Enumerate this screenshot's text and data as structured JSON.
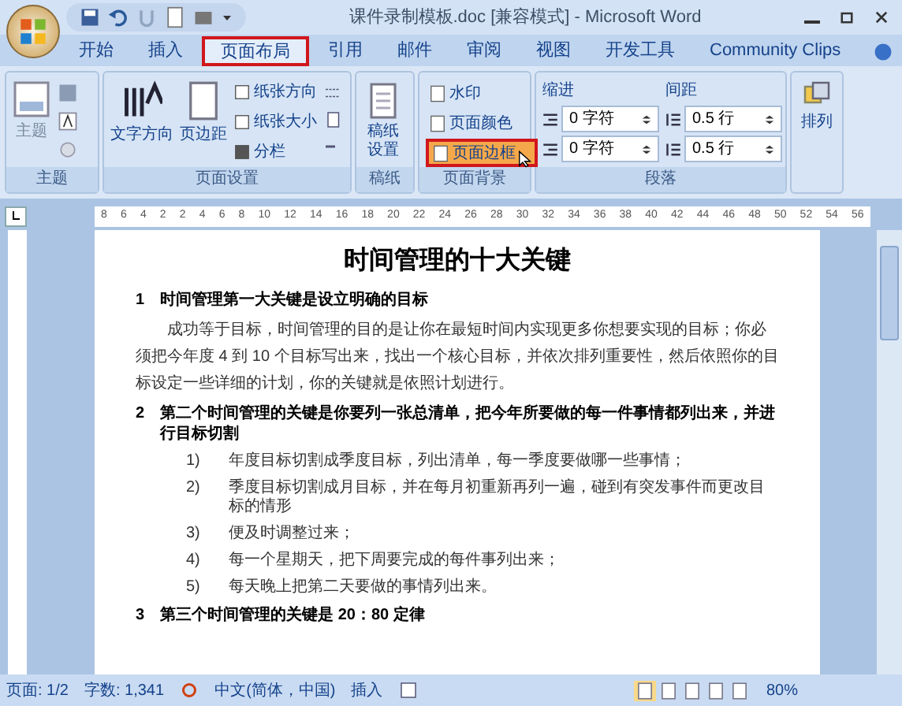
{
  "window": {
    "title": "课件录制模板.doc [兼容模式] - Microsoft Word"
  },
  "tabs": [
    {
      "label": "开始",
      "selected": false
    },
    {
      "label": "插入",
      "selected": false
    },
    {
      "label": "页面布局",
      "selected": true
    },
    {
      "label": "引用",
      "selected": false
    },
    {
      "label": "邮件",
      "selected": false
    },
    {
      "label": "审阅",
      "selected": false
    },
    {
      "label": "视图",
      "selected": false
    },
    {
      "label": "开发工具",
      "selected": false
    },
    {
      "label": "Community Clips",
      "selected": false
    }
  ],
  "ribbon": {
    "theme": {
      "label": "主题",
      "button": "主题"
    },
    "page_setup": {
      "label": "页面设置",
      "buttons": [
        "文字方向",
        "页边距"
      ],
      "menus": [
        "纸张方向",
        "纸张大小",
        "分栏"
      ]
    },
    "manuscript": {
      "label": "稿纸",
      "button": "稿纸设置"
    },
    "background": {
      "label": "页面背景",
      "items": [
        {
          "label": "水印",
          "selected": false
        },
        {
          "label": "页面颜色",
          "selected": false
        },
        {
          "label": "页面边框",
          "selected": true
        }
      ]
    },
    "paragraph": {
      "label": "段落",
      "indent_label": "缩进",
      "spacing_label": "间距",
      "indent": [
        "0 字符",
        "0 字符"
      ],
      "spacing": [
        "0.5 行",
        "0.5 行"
      ]
    },
    "arrange": {
      "button": "排列"
    }
  },
  "ruler": {
    "ticks": [
      "8",
      "6",
      "4",
      "2",
      "2",
      "4",
      "6",
      "8",
      "10",
      "12",
      "14",
      "16",
      "18",
      "20",
      "22",
      "24",
      "26",
      "28",
      "30",
      "32",
      "34",
      "36",
      "38",
      "40",
      "42",
      "44",
      "46",
      "48",
      "50",
      "52",
      "54",
      "56"
    ]
  },
  "document": {
    "title": "时间管理的十大关键",
    "blocks": [
      {
        "kind": "heading",
        "number": "1",
        "text": "时间管理第一大关键是设立明确的目标"
      },
      {
        "kind": "paragraph",
        "text": "成功等于目标，时间管理的目的是让你在最短时间内实现更多你想要实现的目标；你必须把今年度 4 到 10 个目标写出来，找出一个核心目标，并依次排列重要性，然后依照你的目标设定一些详细的计划，你的关键就是依照计划进行。"
      },
      {
        "kind": "heading",
        "number": "2",
        "text": "第二个时间管理的关键是你要列一张总清单，把今年所要做的每一件事情都列出来，并进行目标切割"
      },
      {
        "kind": "item",
        "number": "1)",
        "text": "年度目标切割成季度目标，列出清单，每一季度要做哪一些事情；"
      },
      {
        "kind": "item",
        "number": "2)",
        "text": "季度目标切割成月目标，并在每月初重新再列一遍，碰到有突发事件而更改目标的情形"
      },
      {
        "kind": "item",
        "number": "3)",
        "text": "便及时调整过来；"
      },
      {
        "kind": "item",
        "number": "4)",
        "text": "每一个星期天，把下周要完成的每件事列出来；"
      },
      {
        "kind": "item",
        "number": "5)",
        "text": "每天晚上把第二天要做的事情列出来。"
      },
      {
        "kind": "heading",
        "number": "3",
        "text": "第三个时间管理的关键是 20：80 定律"
      }
    ]
  },
  "status_bar": {
    "page": "页面: 1/2",
    "words": "字数: 1,341",
    "language": "中文(简体，中国)",
    "mode": "插入",
    "zoom": "80%"
  }
}
